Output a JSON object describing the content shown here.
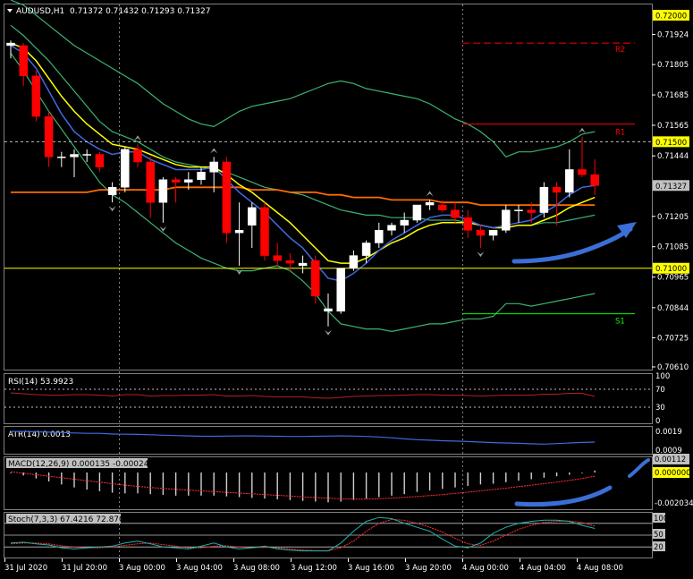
{
  "window": {
    "symbol": "AUDUSD,H1",
    "ohlc": "0.71372 0.71432 0.71293 0.71327"
  },
  "colors": {
    "background": "#000000",
    "bull_candle": "#ffffff",
    "bear_candle": "#ff0000",
    "bollinger": "#3cb371",
    "ma_fast": "#4169e1",
    "ma_mid": "#ffff00",
    "ma_slow": "#ff6a00",
    "pivot_r": "#ff0000",
    "pivot_pp": "#ffff00",
    "pivot_s": "#00ff00",
    "annotation": "#3b6fd6",
    "grid": "#808080"
  },
  "main_panel": {
    "price_axis": [
      "0.71924",
      "0.71805",
      "0.71685",
      "0.71565",
      "0.71444",
      "0.71205",
      "0.71085",
      "0.70965",
      "0.70844",
      "0.70725",
      "0.70610"
    ],
    "price_tags": [
      {
        "label": "0.72000",
        "price": 0.72,
        "bg": "#ffff00"
      },
      {
        "label": "0.71500",
        "price": 0.715,
        "bg": "#ffff00"
      },
      {
        "label": "0.71327",
        "price": 0.71327,
        "bg": "#c0c0c0"
      },
      {
        "label": "0.71000",
        "price": 0.71,
        "bg": "#ffff00"
      }
    ],
    "levels": {
      "R2": {
        "label": "R2",
        "price": 0.7189
      },
      "R1": {
        "label": "R1",
        "price": 0.7157
      },
      "PP": {
        "price": 0.71
      },
      "S1": {
        "label": "S1",
        "price": 0.7082
      },
      "hline": {
        "price": 0.715
      }
    },
    "candles": [
      [
        0.7188,
        0.719,
        0.7183,
        0.7189
      ],
      [
        0.7188,
        0.7189,
        0.7172,
        0.7176
      ],
      [
        0.7176,
        0.7178,
        0.7158,
        0.716
      ],
      [
        0.716,
        0.7162,
        0.714,
        0.7144
      ],
      [
        0.7144,
        0.7146,
        0.714,
        0.7144
      ],
      [
        0.7144,
        0.7147,
        0.7136,
        0.7145
      ],
      [
        0.7145,
        0.7147,
        0.7142,
        0.7145
      ],
      [
        0.7145,
        0.7146,
        0.7138,
        0.714
      ],
      [
        0.7129,
        0.7134,
        0.7126,
        0.7132
      ],
      [
        0.7132,
        0.7148,
        0.713,
        0.7147
      ],
      [
        0.7147,
        0.7149,
        0.714,
        0.7142
      ],
      [
        0.7142,
        0.7144,
        0.712,
        0.7126
      ],
      [
        0.7126,
        0.7136,
        0.7118,
        0.7135
      ],
      [
        0.7135,
        0.7136,
        0.7126,
        0.7134
      ],
      [
        0.7134,
        0.7138,
        0.7131,
        0.7135
      ],
      [
        0.7135,
        0.714,
        0.7133,
        0.7138
      ],
      [
        0.7138,
        0.7144,
        0.713,
        0.7142
      ],
      [
        0.7142,
        0.7144,
        0.711,
        0.7114
      ],
      [
        0.7114,
        0.7126,
        0.7101,
        0.7115
      ],
      [
        0.7117,
        0.7126,
        0.7108,
        0.7124
      ],
      [
        0.7124,
        0.7126,
        0.7103,
        0.7105
      ],
      [
        0.7105,
        0.711,
        0.7101,
        0.7103
      ],
      [
        0.7103,
        0.7106,
        0.7099,
        0.7102
      ],
      [
        0.7101,
        0.7105,
        0.7098,
        0.7102
      ],
      [
        0.7103,
        0.7105,
        0.7086,
        0.7089
      ],
      [
        0.7083,
        0.709,
        0.7077,
        0.7084
      ],
      [
        0.7083,
        0.71,
        0.7082,
        0.71
      ],
      [
        0.71,
        0.7107,
        0.7099,
        0.7105
      ],
      [
        0.7105,
        0.7111,
        0.7102,
        0.711
      ],
      [
        0.711,
        0.7118,
        0.7108,
        0.7115
      ],
      [
        0.7115,
        0.7118,
        0.7113,
        0.7117
      ],
      [
        0.7117,
        0.7122,
        0.7114,
        0.7119
      ],
      [
        0.7119,
        0.7125,
        0.7118,
        0.7125
      ],
      [
        0.7125,
        0.7127,
        0.7123,
        0.7126
      ],
      [
        0.7125,
        0.7127,
        0.7122,
        0.7123
      ],
      [
        0.7123,
        0.7126,
        0.7118,
        0.712
      ],
      [
        0.712,
        0.7123,
        0.7112,
        0.7115
      ],
      [
        0.7115,
        0.7117,
        0.7108,
        0.7113
      ],
      [
        0.7113,
        0.7115,
        0.7111,
        0.7115
      ],
      [
        0.7115,
        0.7125,
        0.7114,
        0.7123
      ],
      [
        0.7123,
        0.7125,
        0.7118,
        0.7123
      ],
      [
        0.7123,
        0.7126,
        0.7118,
        0.7122
      ],
      [
        0.7122,
        0.7134,
        0.712,
        0.7132
      ],
      [
        0.7132,
        0.7134,
        0.7117,
        0.713
      ],
      [
        0.713,
        0.7147,
        0.7128,
        0.7139
      ],
      [
        0.7139,
        0.7152,
        0.7136,
        0.7137
      ],
      [
        0.7137,
        0.7143,
        0.7129,
        0.71327
      ]
    ],
    "bb_upper": [
      0.7206,
      0.7204,
      0.72,
      0.7196,
      0.7192,
      0.7188,
      0.7185,
      0.7182,
      0.7179,
      0.7176,
      0.7173,
      0.7169,
      0.7165,
      0.7162,
      0.7159,
      0.7157,
      0.7156,
      0.7159,
      0.7162,
      0.7164,
      0.7165,
      0.7166,
      0.7167,
      0.7169,
      0.7171,
      0.7173,
      0.7174,
      0.7173,
      0.7171,
      0.717,
      0.7169,
      0.7168,
      0.7167,
      0.7165,
      0.7162,
      0.7159,
      0.7157,
      0.7154,
      0.715,
      0.7144,
      0.7146,
      0.7146,
      0.7147,
      0.7148,
      0.715,
      0.7153,
      0.7154
    ],
    "bb_mid": [
      0.7196,
      0.7192,
      0.7187,
      0.7182,
      0.7176,
      0.717,
      0.7164,
      0.7158,
      0.7154,
      0.7152,
      0.715,
      0.7147,
      0.7144,
      0.7142,
      0.7141,
      0.714,
      0.7139,
      0.7138,
      0.7136,
      0.7134,
      0.7132,
      0.7131,
      0.713,
      0.7129,
      0.7127,
      0.7125,
      0.7123,
      0.7122,
      0.7121,
      0.7121,
      0.712,
      0.712,
      0.712,
      0.7119,
      0.7119,
      0.7119,
      0.7118,
      0.7117,
      0.7116,
      0.7116,
      0.7117,
      0.7117,
      0.7118,
      0.7118,
      0.7119,
      0.712,
      0.7121
    ],
    "bb_lower": [
      0.7185,
      0.7178,
      0.717,
      0.7162,
      0.7155,
      0.7148,
      0.7141,
      0.7134,
      0.7129,
      0.7126,
      0.7122,
      0.7118,
      0.7114,
      0.711,
      0.7107,
      0.7104,
      0.7102,
      0.71,
      0.7099,
      0.7099,
      0.71,
      0.7101,
      0.7099,
      0.7095,
      0.709,
      0.7083,
      0.7078,
      0.7077,
      0.7076,
      0.7076,
      0.7075,
      0.7076,
      0.7077,
      0.7078,
      0.7078,
      0.7079,
      0.708,
      0.708,
      0.7081,
      0.7086,
      0.7086,
      0.7085,
      0.7086,
      0.7087,
      0.7088,
      0.7089,
      0.709
    ],
    "ma_fast": [
      0.7188,
      0.7185,
      0.7179,
      0.717,
      0.7161,
      0.7154,
      0.715,
      0.7147,
      0.7145,
      0.7146,
      0.7146,
      0.7143,
      0.7141,
      0.7139,
      0.7139,
      0.7139,
      0.714,
      0.7135,
      0.713,
      0.7126,
      0.7122,
      0.7117,
      0.7112,
      0.7108,
      0.7102,
      0.7096,
      0.7095,
      0.7098,
      0.7102,
      0.7107,
      0.7111,
      0.7114,
      0.7117,
      0.712,
      0.7121,
      0.7121,
      0.7119,
      0.7117,
      0.7116,
      0.7117,
      0.7118,
      0.7119,
      0.7122,
      0.7125,
      0.7129,
      0.7132,
      0.71327
    ],
    "ma_mid": [
      0.7189,
      0.7187,
      0.7182,
      0.7175,
      0.7168,
      0.7162,
      0.7157,
      0.7153,
      0.7149,
      0.7148,
      0.7147,
      0.7145,
      0.7143,
      0.7141,
      0.714,
      0.714,
      0.714,
      0.7137,
      0.7133,
      0.713,
      0.7126,
      0.7122,
      0.7118,
      0.7113,
      0.7108,
      0.7103,
      0.7102,
      0.7102,
      0.7104,
      0.7107,
      0.711,
      0.7112,
      0.7115,
      0.7117,
      0.7118,
      0.7118,
      0.7118,
      0.7117,
      0.7116,
      0.7116,
      0.7117,
      0.7117,
      0.7119,
      0.7121,
      0.7124,
      0.7126,
      0.7128
    ],
    "ma_slow": [
      0.713,
      0.713,
      0.713,
      0.713,
      0.713,
      0.713,
      0.713,
      0.7131,
      0.7131,
      0.7131,
      0.7131,
      0.7131,
      0.7131,
      0.7132,
      0.7132,
      0.7132,
      0.7132,
      0.7132,
      0.7132,
      0.7131,
      0.7131,
      0.7131,
      0.713,
      0.713,
      0.713,
      0.7129,
      0.7129,
      0.7128,
      0.7128,
      0.7128,
      0.7127,
      0.7127,
      0.7127,
      0.7127,
      0.7126,
      0.7126,
      0.7126,
      0.7125,
      0.7125,
      0.7125,
      0.7125,
      0.7125,
      0.7125,
      0.7125,
      0.7125,
      0.7125,
      0.7125
    ],
    "fractals_up": [
      [
        10,
        0.7149
      ],
      [
        16,
        0.7144
      ],
      [
        33,
        0.7127
      ],
      [
        45,
        0.7152
      ]
    ],
    "fractals_down": [
      [
        8,
        0.7126
      ],
      [
        12,
        0.7118
      ],
      [
        18,
        0.7101
      ],
      [
        25,
        0.7077
      ],
      [
        37,
        0.7108
      ]
    ]
  },
  "rsi_panel": {
    "title": "RSI(14) 53.9923",
    "axis": [
      "100",
      "70",
      "30",
      "0"
    ],
    "levels": [
      70,
      30
    ],
    "values": [
      62,
      60,
      58,
      57,
      57,
      58,
      58,
      57,
      55,
      58,
      58,
      55,
      56,
      56,
      57,
      57,
      58,
      55,
      55,
      56,
      54,
      53,
      53,
      53,
      51,
      50,
      52,
      54,
      55,
      56,
      56,
      57,
      58,
      58,
      57,
      57,
      56,
      55,
      56,
      57,
      57,
      57,
      59,
      59,
      61,
      61,
      54
    ]
  },
  "atr_panel": {
    "title": "ATR(14) 0.0013",
    "axis": [
      "0.0019",
      "0.0009"
    ],
    "values": [
      0.0019,
      0.0019,
      0.00188,
      0.00186,
      0.00184,
      0.00182,
      0.0018,
      0.0018,
      0.00176,
      0.00175,
      0.00174,
      0.00172,
      0.0017,
      0.00168,
      0.00166,
      0.00164,
      0.00164,
      0.00165,
      0.00166,
      0.00166,
      0.00165,
      0.00164,
      0.00163,
      0.00163,
      0.00164,
      0.00165,
      0.00166,
      0.00165,
      0.00163,
      0.0016,
      0.00156,
      0.0015,
      0.00146,
      0.00143,
      0.0014,
      0.00138,
      0.00136,
      0.00133,
      0.0013,
      0.00128,
      0.00126,
      0.00124,
      0.00122,
      0.00125,
      0.00128,
      0.00131,
      0.00133
    ]
  },
  "macd_panel": {
    "title": "MACD(12,26,9) 0.000135 -0.000249",
    "axis": [
      "0.00112",
      "0.000000",
      "-0.002034"
    ],
    "hist": [
      -5e-05,
      -0.0002,
      -0.0004,
      -0.0006,
      -0.0008,
      -0.001,
      -0.00115,
      -0.00125,
      -0.00135,
      -0.0014,
      -0.0014,
      -0.00145,
      -0.0015,
      -0.00155,
      -0.00155,
      -0.00155,
      -0.00155,
      -0.0016,
      -0.00165,
      -0.0017,
      -0.00175,
      -0.0018,
      -0.00185,
      -0.0019,
      -0.00195,
      -0.002,
      -0.00195,
      -0.00185,
      -0.00175,
      -0.00165,
      -0.00155,
      -0.00145,
      -0.0013,
      -0.0012,
      -0.0011,
      -0.001,
      -0.0009,
      -0.0008,
      -0.00075,
      -0.00065,
      -0.00055,
      -0.00045,
      -0.00035,
      -0.00025,
      -0.00015,
      -5e-05,
      0.000135
    ],
    "signal": [
      5e-05,
      -5e-05,
      -0.00015,
      -0.00025,
      -0.00035,
      -0.00045,
      -0.00055,
      -0.00065,
      -0.00075,
      -0.00085,
      -0.00093,
      -0.001,
      -0.00107,
      -0.00113,
      -0.00118,
      -0.00123,
      -0.00128,
      -0.00133,
      -0.00138,
      -0.00143,
      -0.00148,
      -0.00153,
      -0.00158,
      -0.00163,
      -0.00168,
      -0.00172,
      -0.00176,
      -0.00178,
      -0.00178,
      -0.00176,
      -0.00172,
      -0.00167,
      -0.00161,
      -0.00155,
      -0.00148,
      -0.0014,
      -0.00132,
      -0.00123,
      -0.00114,
      -0.00105,
      -0.00095,
      -0.00085,
      -0.00075,
      -0.00064,
      -0.00053,
      -0.0004,
      -0.000249
    ]
  },
  "stoch_panel": {
    "title": "Stoch(7,3,3) 67.4216 72.8706",
    "axis": [
      "100",
      "50",
      "20"
    ],
    "k": [
      30,
      32,
      28,
      25,
      18,
      15,
      18,
      20,
      22,
      30,
      35,
      28,
      20,
      18,
      15,
      22,
      30,
      20,
      15,
      18,
      22,
      15,
      12,
      10,
      10,
      10,
      30,
      60,
      85,
      95,
      92,
      80,
      70,
      60,
      40,
      22,
      18,
      30,
      55,
      70,
      80,
      85,
      88,
      88,
      85,
      75,
      67
    ],
    "d": [
      28,
      30,
      30,
      28,
      23,
      20,
      18,
      18,
      20,
      24,
      28,
      30,
      26,
      22,
      18,
      18,
      22,
      23,
      20,
      18,
      19,
      18,
      15,
      12,
      11,
      10,
      18,
      35,
      60,
      80,
      90,
      88,
      80,
      70,
      58,
      42,
      28,
      24,
      35,
      50,
      65,
      75,
      82,
      85,
      86,
      82,
      73
    ]
  },
  "time_axis": [
    "31 Jul 2020",
    "31 Jul 20:00",
    "3 Aug 00:00",
    "3 Aug 04:00",
    "3 Aug 08:00",
    "3 Aug 12:00",
    "3 Aug 16:00",
    "3 Aug 20:00",
    "4 Aug 00:00",
    "4 Aug 04:00",
    "4 Aug 08:00"
  ]
}
